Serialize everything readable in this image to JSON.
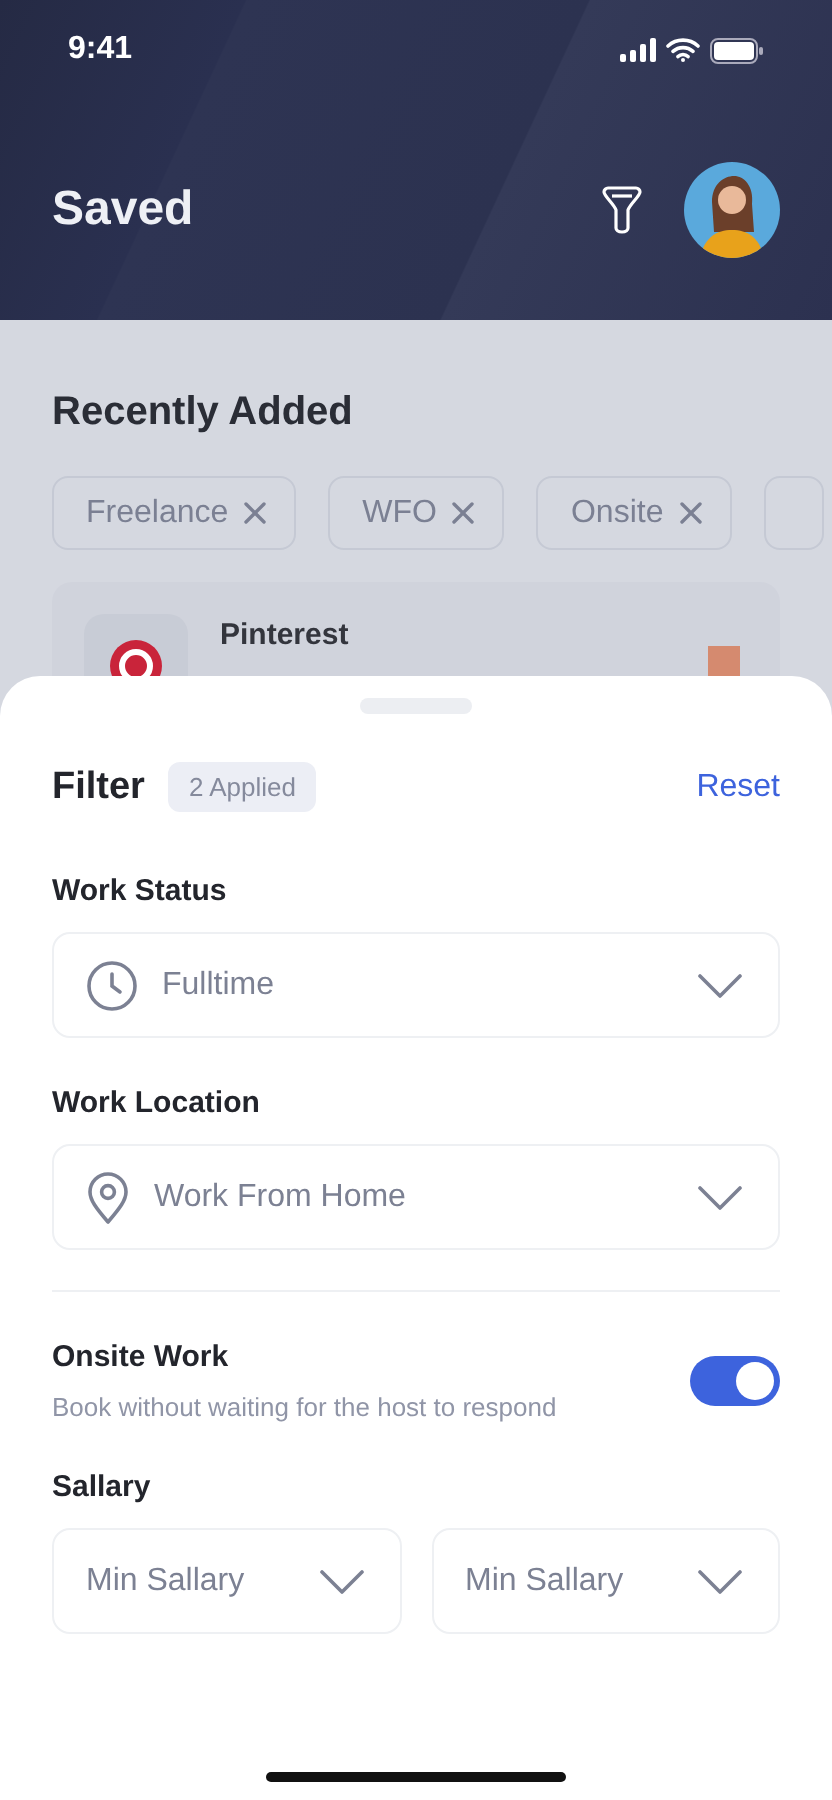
{
  "status_bar": {
    "time": "9:41"
  },
  "header": {
    "title": "Saved"
  },
  "recent": {
    "title": "Recently Added",
    "chips": [
      {
        "label": "Freelance"
      },
      {
        "label": "WFO"
      },
      {
        "label": "Onsite"
      }
    ],
    "card": {
      "name": "Pinterest"
    }
  },
  "sheet": {
    "title": "Filter",
    "badge": "2 Applied",
    "reset": "Reset",
    "fields": [
      {
        "label": "Work Status",
        "value": "Fulltime",
        "kind": "clock"
      },
      {
        "label": "Work Location",
        "value": "Work From Home",
        "kind": "pin"
      }
    ],
    "onsite": {
      "label": "Onsite Work",
      "description": "Book without waiting for the host to respond",
      "on": true
    },
    "salary": {
      "label": "Sallary",
      "selects": [
        {
          "placeholder": "Min Sallary"
        },
        {
          "placeholder": "Min Sallary"
        }
      ]
    }
  }
}
